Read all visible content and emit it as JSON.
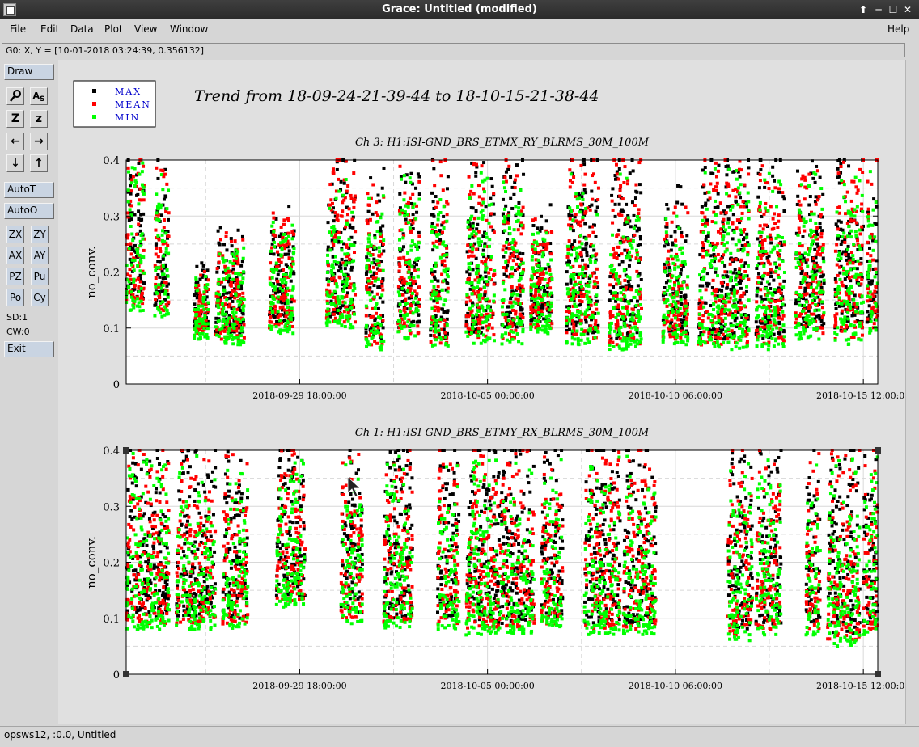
{
  "window": {
    "title": "Grace: Untitled (modified)",
    "controls": {
      "up": "⬆",
      "minimize": "─",
      "maximize": "☐",
      "close": "✕"
    }
  },
  "menu": {
    "file": "File",
    "edit": "Edit",
    "data": "Data",
    "plot": "Plot",
    "view": "View",
    "window": "Window",
    "help": "Help"
  },
  "locator": "G0: X, Y = [10-01-2018 03:24:39, 0.356132]",
  "toolbar": {
    "draw": "Draw",
    "autot": "AutoT",
    "autoo": "AutoO",
    "zx": "ZX",
    "zy": "ZY",
    "ax": "AX",
    "ay": "AY",
    "pz": "PZ",
    "pu": "Pu",
    "po": "Po",
    "cy": "Cy",
    "sd": "SD:1",
    "cw": "CW:0",
    "exit": "Exit",
    "icons": {
      "zoom": "magnifier-icon",
      "text": "text-icon",
      "zoom_in": "Z",
      "zoom_out": "z",
      "left": "←",
      "right": "→",
      "down": "↓",
      "up": "↑"
    }
  },
  "legend": [
    {
      "label": "MAX",
      "color": "#000000"
    },
    {
      "label": "MEAN",
      "color": "#ff0000"
    },
    {
      "label": "MIN",
      "color": "#00ff00"
    }
  ],
  "page_title": "Trend from 18-09-24-21-39-44 to 18-10-15-21-38-44",
  "chart_data": [
    {
      "type": "scatter",
      "title": "Ch 3: H1:ISI-GND_BRS_ETMX_RY_BLRMS_30M_100M",
      "xlabel": "",
      "ylabel": "no_conv.",
      "ylim": [
        0,
        0.4
      ],
      "yticks": [
        "0",
        "0.1",
        "0.2",
        "0.3",
        "0.4"
      ],
      "xlim": [
        "2018-09-24 21:39:44",
        "2018-10-15 21:38:44"
      ],
      "xticks": [
        "2018-09-29 18:00:00",
        "2018-10-05 00:00:00",
        "2018-10-10 06:00:00",
        "2018-10-15 12:00:00"
      ],
      "grid": true,
      "series": [
        {
          "name": "MAX",
          "color": "#000000"
        },
        {
          "name": "MEAN",
          "color": "#ff0000"
        },
        {
          "name": "MIN",
          "color": "#00ff00"
        }
      ],
      "segments_days": [
        [
          0.0,
          0.5,
          0.42,
          0.13
        ],
        [
          0.8,
          1.2,
          0.4,
          0.12
        ],
        [
          1.9,
          2.3,
          0.2,
          0.08
        ],
        [
          2.5,
          3.3,
          0.26,
          0.07
        ],
        [
          4.0,
          4.7,
          0.3,
          0.09
        ],
        [
          5.6,
          6.4,
          0.4,
          0.1
        ],
        [
          6.7,
          7.2,
          0.37,
          0.06
        ],
        [
          7.6,
          8.2,
          0.4,
          0.08
        ],
        [
          8.5,
          9.0,
          0.41,
          0.06
        ],
        [
          9.5,
          10.3,
          0.4,
          0.07
        ],
        [
          10.5,
          11.1,
          0.42,
          0.07
        ],
        [
          11.3,
          11.9,
          0.3,
          0.09
        ],
        [
          12.3,
          13.2,
          0.41,
          0.07
        ],
        [
          13.5,
          14.4,
          0.41,
          0.06
        ],
        [
          15.0,
          15.7,
          0.33,
          0.07
        ],
        [
          16.0,
          17.4,
          0.41,
          0.06
        ],
        [
          17.6,
          18.4,
          0.4,
          0.06
        ],
        [
          18.7,
          19.5,
          0.4,
          0.08
        ],
        [
          19.8,
          20.6,
          0.41,
          0.07
        ],
        [
          20.7,
          21.0,
          0.42,
          0.09
        ]
      ]
    },
    {
      "type": "scatter",
      "title": "Ch 1: H1:ISI-GND_BRS_ETMY_RX_BLRMS_30M_100M",
      "xlabel": "",
      "ylabel": "no_conv.",
      "ylim": [
        0,
        0.4
      ],
      "yticks": [
        "0",
        "0.1",
        "0.2",
        "0.3",
        "0.4"
      ],
      "xlim": [
        "2018-09-24 21:39:44",
        "2018-10-15 21:38:44"
      ],
      "xticks": [
        "2018-09-29 18:00:00",
        "2018-10-05 00:00:00",
        "2018-10-10 06:00:00",
        "2018-10-15 12:00:00"
      ],
      "grid": true,
      "series": [
        {
          "name": "MAX",
          "color": "#000000"
        },
        {
          "name": "MEAN",
          "color": "#ff0000"
        },
        {
          "name": "MIN",
          "color": "#00ff00"
        }
      ],
      "segments_days": [
        [
          0.0,
          1.2,
          0.42,
          0.08
        ],
        [
          1.4,
          2.5,
          0.41,
          0.08
        ],
        [
          2.7,
          3.4,
          0.4,
          0.08
        ],
        [
          4.2,
          5.0,
          0.41,
          0.12
        ],
        [
          6.0,
          6.6,
          0.41,
          0.09
        ],
        [
          7.2,
          8.0,
          0.41,
          0.08
        ],
        [
          8.7,
          9.3,
          0.41,
          0.08
        ],
        [
          9.5,
          11.4,
          0.41,
          0.07
        ],
        [
          11.6,
          12.2,
          0.41,
          0.08
        ],
        [
          12.8,
          13.8,
          0.41,
          0.07
        ],
        [
          13.9,
          14.8,
          0.41,
          0.07
        ],
        [
          16.8,
          17.5,
          0.41,
          0.06
        ],
        [
          17.6,
          18.3,
          0.41,
          0.07
        ],
        [
          19.0,
          19.4,
          0.4,
          0.07
        ],
        [
          19.6,
          20.5,
          0.41,
          0.05
        ],
        [
          20.6,
          21.0,
          0.41,
          0.07
        ]
      ]
    }
  ],
  "status": "opsws12, :0.0, Untitled"
}
